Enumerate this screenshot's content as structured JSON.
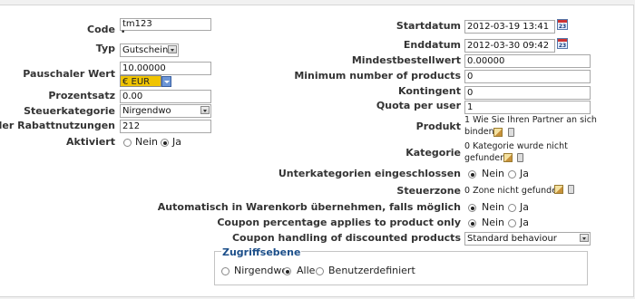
{
  "left": {
    "code": {
      "label": "Code",
      "value": "tm123"
    },
    "typ": {
      "label": "Typ",
      "value": "Gutscheine"
    },
    "pauschaler_wert": {
      "label": "Pauschaler Wert",
      "value": "10.00000",
      "currency": "€ EUR"
    },
    "prozentsatz": {
      "label": "Prozentsatz",
      "value": "0.00"
    },
    "steuerkategorie": {
      "label": "Steuerkategorie",
      "value": "Nirgendwo"
    },
    "rabattnutzungen": {
      "label": "zahl der Rabattnutzungen",
      "value": "212"
    },
    "aktiviert": {
      "label": "Aktiviert",
      "options": [
        "Nein",
        "Ja"
      ],
      "selected": "Ja"
    }
  },
  "right": {
    "startdatum": {
      "label": "Startdatum",
      "value": "2012-03-19 13:41"
    },
    "enddatum": {
      "label": "Enddatum",
      "value": "2012-03-30 09:42"
    },
    "mindestbestellwert": {
      "label": "Mindestbestellwert",
      "value": "0.00000"
    },
    "min_products": {
      "label": "Minimum number of products",
      "value": "0"
    },
    "kontingent": {
      "label": "Kontingent",
      "value": "0"
    },
    "quota": {
      "label": "Quota per user",
      "value": "1"
    },
    "produkt": {
      "label": "Produkt",
      "value_line1": "1 Wie Sie Ihren Partner an sich",
      "value_line2": "binden"
    },
    "kategorie": {
      "label": "Kategorie",
      "value_line1": "0 Kategorie wurde nicht",
      "value_line2": "gefunden"
    },
    "unterkategorien": {
      "label": "Unterkategorien eingeschlossen",
      "options": [
        "Nein",
        "Ja"
      ],
      "selected": "Nein"
    },
    "steuerzone": {
      "label": "Steuerzone",
      "value": "0 Zone nicht gefunden"
    },
    "auto_warenkorb": {
      "label": "Automatisch in Warenkorb übernehmen, falls möglich",
      "options": [
        "Nein",
        "Ja"
      ],
      "selected": "Nein"
    },
    "coupon_pct": {
      "label": "Coupon percentage applies to product only",
      "options": [
        "Nein",
        "Ja"
      ],
      "selected": "Nein"
    },
    "coupon_discounted": {
      "label": "Coupon handling of discounted products",
      "value": "Standard behaviour"
    }
  },
  "zugriffsebene": {
    "legend": "Zugriffsebene",
    "options": [
      "Nirgendwo",
      "Alle",
      "Benutzerdefiniert"
    ],
    "selected": "Alle"
  },
  "icons": {
    "calendar_day": "23"
  }
}
